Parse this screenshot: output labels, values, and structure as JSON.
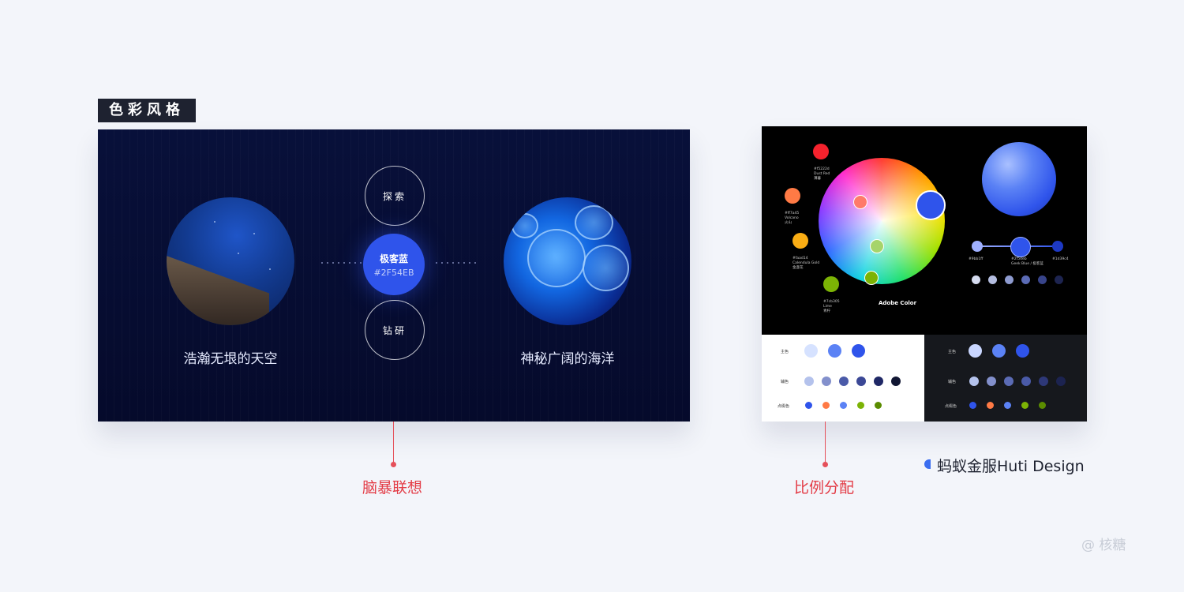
{
  "section_title": "色彩风格",
  "left_panel": {
    "center_name": "极客蓝",
    "center_hex": "#2F54EB",
    "top_keyword": "探索",
    "bottom_keyword": "钻研",
    "left_caption": "浩瀚无垠的天空",
    "right_caption": "神秘广阔的海洋"
  },
  "right_panel": {
    "wheel_label": "Adobe Color",
    "swatches": [
      {
        "hex": "#f5222d",
        "name": "Dust Red",
        "zh": "薄暮",
        "color": "#f5222d"
      },
      {
        "hex": "#ff7a45",
        "name": "Volcano",
        "zh": "火山",
        "color": "#ff7a45"
      },
      {
        "hex": "#faad14",
        "name": "Calendula Gold",
        "zh": "金盏花",
        "color": "#faad14"
      },
      {
        "hex": "#7cb305",
        "name": "Lime",
        "zh": "青柠",
        "color": "#7cb305"
      }
    ],
    "slider_labels": [
      "#9bb1ff",
      "#2f54eb",
      "#1d39c4"
    ],
    "slider_sub": "Geek Blue / 极客蓝",
    "row_labels": [
      "主色",
      "辅色",
      "点缀色"
    ]
  },
  "labels": {
    "left_connector": "脑暴联想",
    "right_connector": "比例分配"
  },
  "brand": "蚂蚁金服Huti Design",
  "watermark": "@ 核糖",
  "colors": {
    "accent_blue": "#2f54eb",
    "connector_red": "#e33b45",
    "tag_bg": "#1e2230"
  }
}
